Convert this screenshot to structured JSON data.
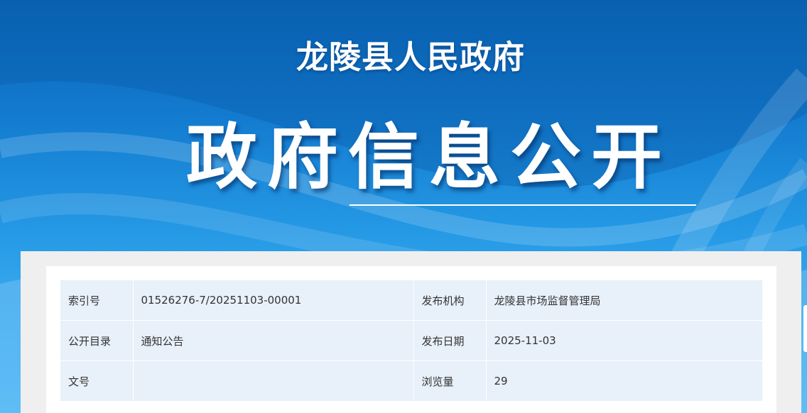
{
  "header": {
    "site_title": "龙陵县人民政府",
    "section_title": "政府信息公开"
  },
  "info_table": {
    "rows": [
      {
        "label_left": "索引号",
        "value_left": "01526276-7/20251103-00001",
        "label_right": "发布机构",
        "value_right": "龙陵县市场监督管理局"
      },
      {
        "label_left": "公开目录",
        "value_left": "通知公告",
        "label_right": "发布日期",
        "value_right": "2025-11-03"
      },
      {
        "label_left": "文号",
        "value_left": "",
        "label_right": "浏览量",
        "value_right": "29"
      }
    ]
  },
  "colors": {
    "banner_blue": "#137bcf",
    "cell_background": "#e8f0f9",
    "text": "#333333"
  }
}
